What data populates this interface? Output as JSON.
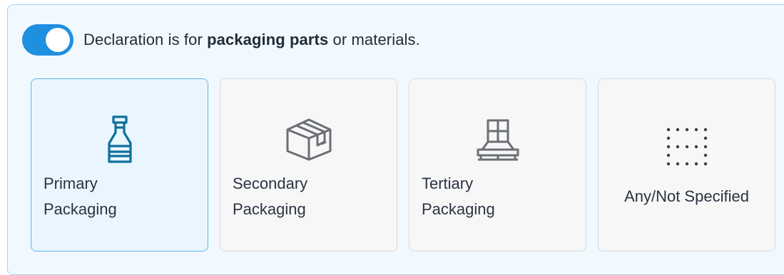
{
  "packaging_toggle": {
    "state": "on",
    "label_prefix": "Declaration is for ",
    "label_bold": "packaging parts",
    "label_suffix": " or materials."
  },
  "packaging_options": [
    {
      "line1": "Primary",
      "line2": "Packaging",
      "icon": "bottle-icon",
      "selected": true
    },
    {
      "line1": "Secondary",
      "line2": "Packaging",
      "icon": "box-icon",
      "selected": false
    },
    {
      "line1": "Tertiary",
      "line2": "Packaging",
      "icon": "pallet-icon",
      "selected": false
    },
    {
      "line1": "Any/Not Specified",
      "icon": "dot-grid-icon",
      "selected": false
    }
  ],
  "colors": {
    "toggle_on": "#1f8fe0",
    "selected_icon": "#0f6f9c",
    "unselected_icon": "#6b6f74",
    "panel_background": "#f1f9fe"
  }
}
